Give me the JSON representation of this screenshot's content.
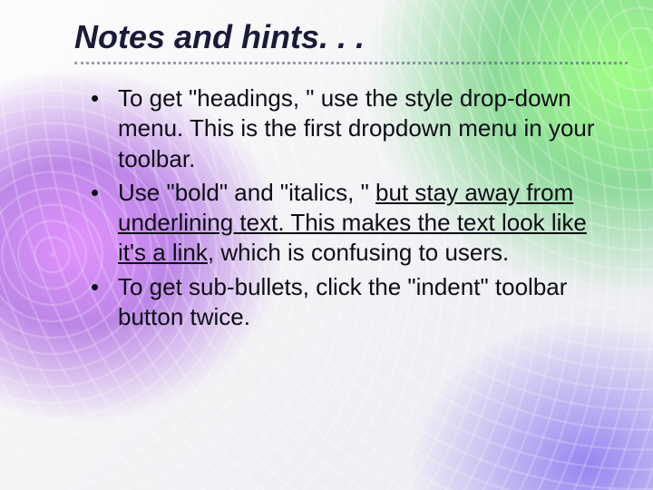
{
  "title": "Notes and hints. . .",
  "bullets": [
    {
      "pre": "To get \"headings, \" use the style drop-down menu. This is the first dropdown menu in your toolbar."
    },
    {
      "pre": "Use \"bold\" and \"italics, \" ",
      "underlined": "but stay away from underlining text. This makes the text look like it's a link",
      "post": ", which is confusing to users."
    },
    {
      "pre": "To get sub-bullets, click the \"indent\" toolbar button twice."
    }
  ]
}
